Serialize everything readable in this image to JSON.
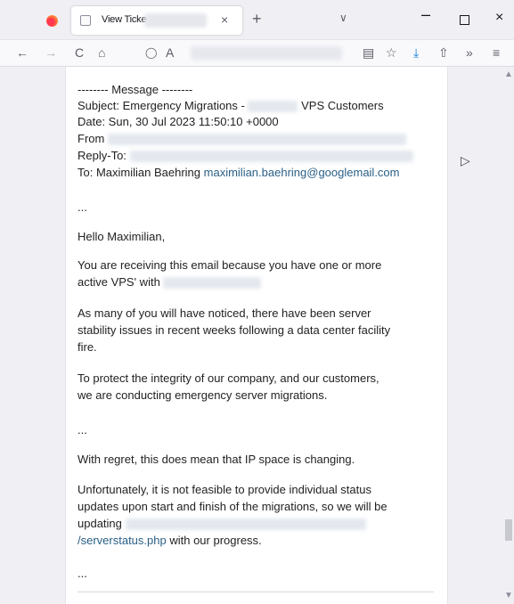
{
  "browser": {
    "tab_title": "View Ticke",
    "tab_close": "×",
    "new_tab": "+",
    "tab_list": "∨",
    "window": {
      "minimize": "–",
      "close": "×"
    },
    "nav": {
      "back": "←",
      "forward": "→",
      "reload": "C",
      "home": "⌂",
      "shield": "◯",
      "lock": "A",
      "reader": "▤",
      "star": "☆",
      "download": "⤓",
      "share": "⇧",
      "overflow": "»",
      "menu": "≡"
    }
  },
  "email": {
    "header_marker": "-------- Message --------",
    "subject_prefix": "Subject: Emergency Migrations -",
    "subject_suffix": "VPS Customers",
    "date": "Date: Sun, 30 Jul 2023 11:50:10 +0000",
    "from_label": "From",
    "reply_to_label": "Reply-To:",
    "to_label": "To: Maximilian Baehring",
    "to_email": "maximilian.baehring@googlemail.com",
    "ellipsis1": "...",
    "greeting": "Hello Maximilian,",
    "p1_line1": "You are receiving this email because you have one or more",
    "p1_line2": "active VPS' with",
    "p2_line1": "As many of you will have noticed, there have been server",
    "p2_line2": "stability issues in recent weeks following a data center facility",
    "p2_line3": "fire.",
    "p3_line1": "To protect the integrity of our company, and our customers,",
    "p3_line2": "we are conducting emergency server migrations.",
    "ellipsis2": "...",
    "p4": "With regret, this does mean that IP space is changing.",
    "p5_line1": "Unfortunately, it is not feasible to provide individual status",
    "p5_line2": "updates upon start and finish of the migrations, so we will be",
    "p5_line3": "updating",
    "p5_link": "/serverstatus.php",
    "p5_after": "with our progress.",
    "ellipsis3": "..."
  },
  "scrollbar": {
    "up": "▲",
    "down": "▼"
  }
}
